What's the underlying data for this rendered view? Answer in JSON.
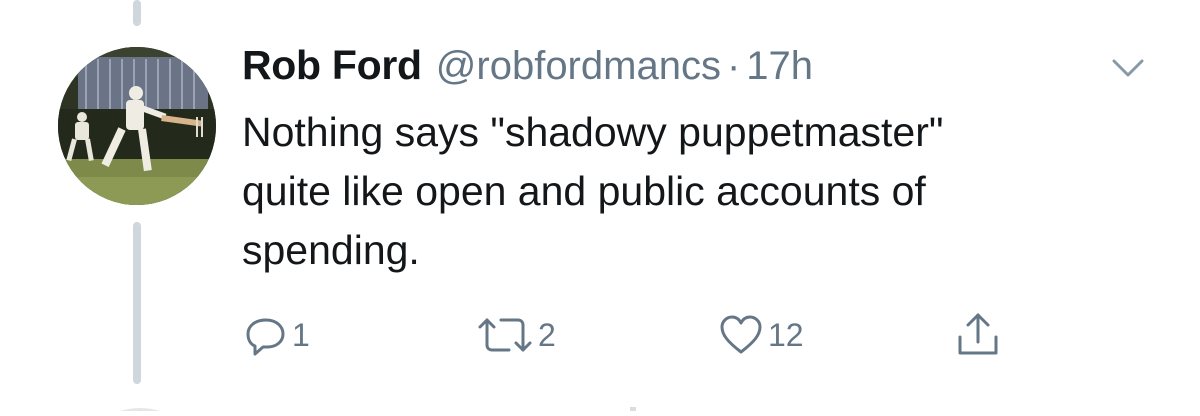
{
  "tweet": {
    "author_name": "Rob Ford",
    "author_handle": "@robfordmancs",
    "separator": "·",
    "timestamp": "17h",
    "text_lines": [
      "Nothing says \"shadowy puppetmaster\"",
      "quite like open and public accounts of",
      "spending."
    ]
  },
  "actions": {
    "reply": {
      "icon": "reply-icon",
      "count": "1"
    },
    "retweet": {
      "icon": "retweet-icon",
      "count": "2"
    },
    "like": {
      "icon": "heart-icon",
      "count": "12"
    },
    "share": {
      "icon": "share-icon",
      "count": ""
    }
  },
  "menu": {
    "icon": "chevron-down-icon"
  },
  "avatar": {
    "icon": "avatar-cricket-photo"
  },
  "colors": {
    "text_primary": "#14171a",
    "text_secondary": "#657786",
    "thread_line": "#cfd6dc",
    "icon_gray": "#8899a6"
  }
}
